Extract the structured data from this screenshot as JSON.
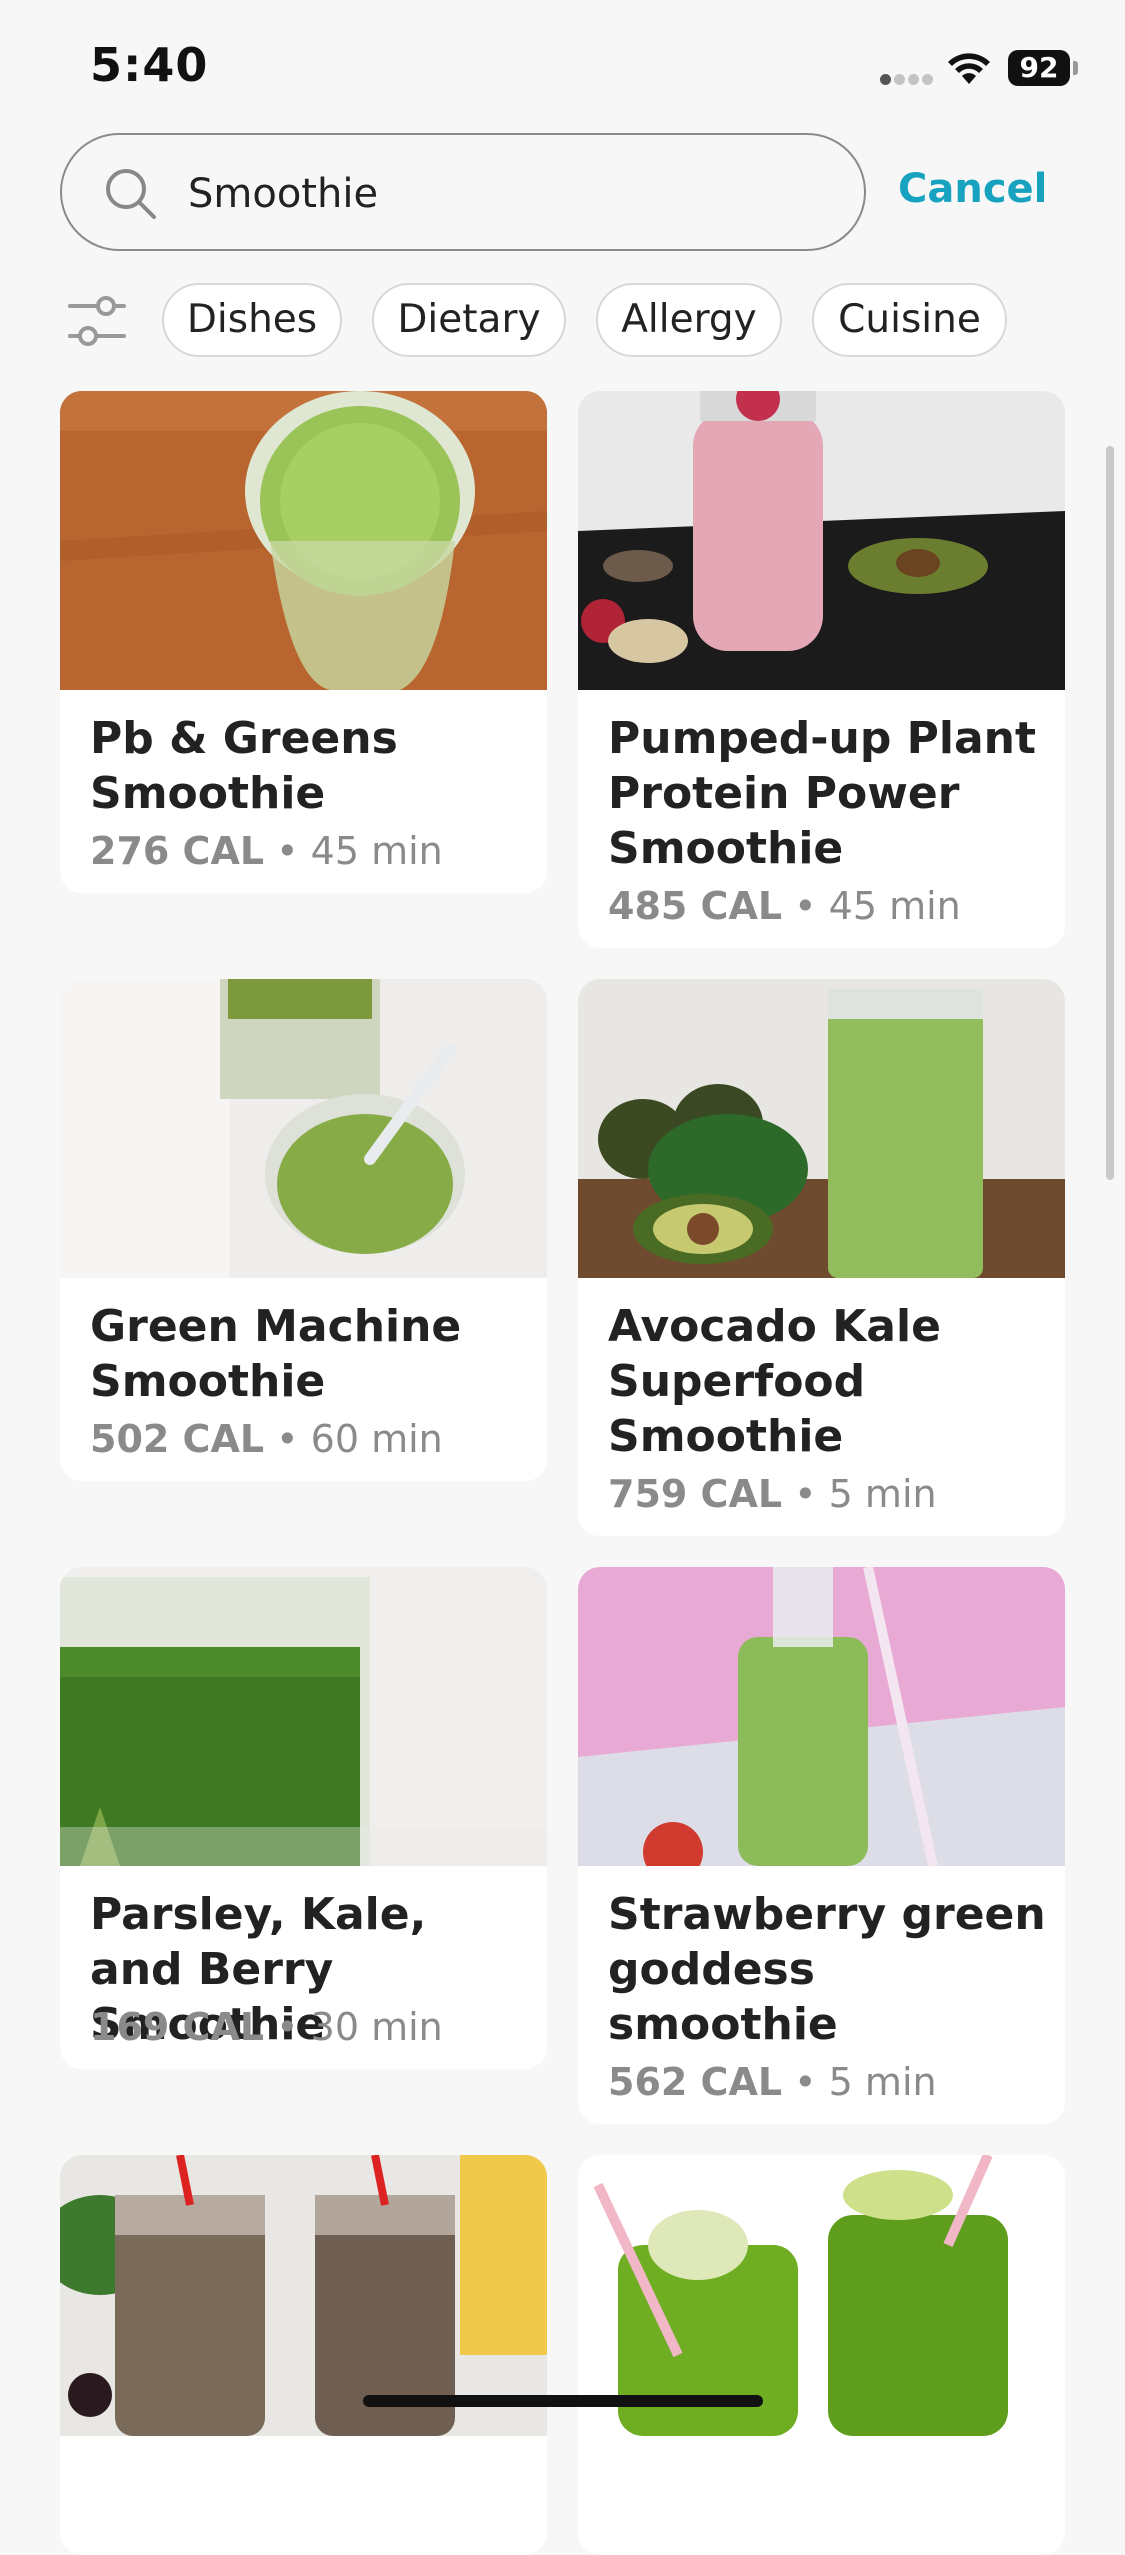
{
  "status_bar": {
    "time": "5:40",
    "battery": "92"
  },
  "search": {
    "value": "Smoothie",
    "cancel_label": "Cancel"
  },
  "filters": [
    "Dishes",
    "Dietary",
    "Allergy",
    "Cuisine"
  ],
  "recipes": [
    {
      "title": "Pb & Greens Smoothie",
      "cal": "276 CAL",
      "sep": "•",
      "time": "45 min"
    },
    {
      "title": "Pumped-up Plant Protein Power Smoothie",
      "cal": "485 CAL",
      "sep": "•",
      "time": "45 min"
    },
    {
      "title": "Green Machine Smoothie",
      "cal": "502 CAL",
      "sep": "•",
      "time": "60 min"
    },
    {
      "title": "Avocado Kale Superfood Smoothie",
      "cal": "759 CAL",
      "sep": "•",
      "time": "5 min"
    },
    {
      "title": "Parsley, Kale, and Berry Smoothie",
      "cal": "169 CAL",
      "sep": "•",
      "time": "30 min"
    },
    {
      "title": "Strawberry green goddess smoothie",
      "cal": "562 CAL",
      "sep": "•",
      "time": "5 min"
    }
  ],
  "colors": {
    "accent": "#17a3c0",
    "background": "#f7f7f7",
    "card": "#ffffff"
  }
}
